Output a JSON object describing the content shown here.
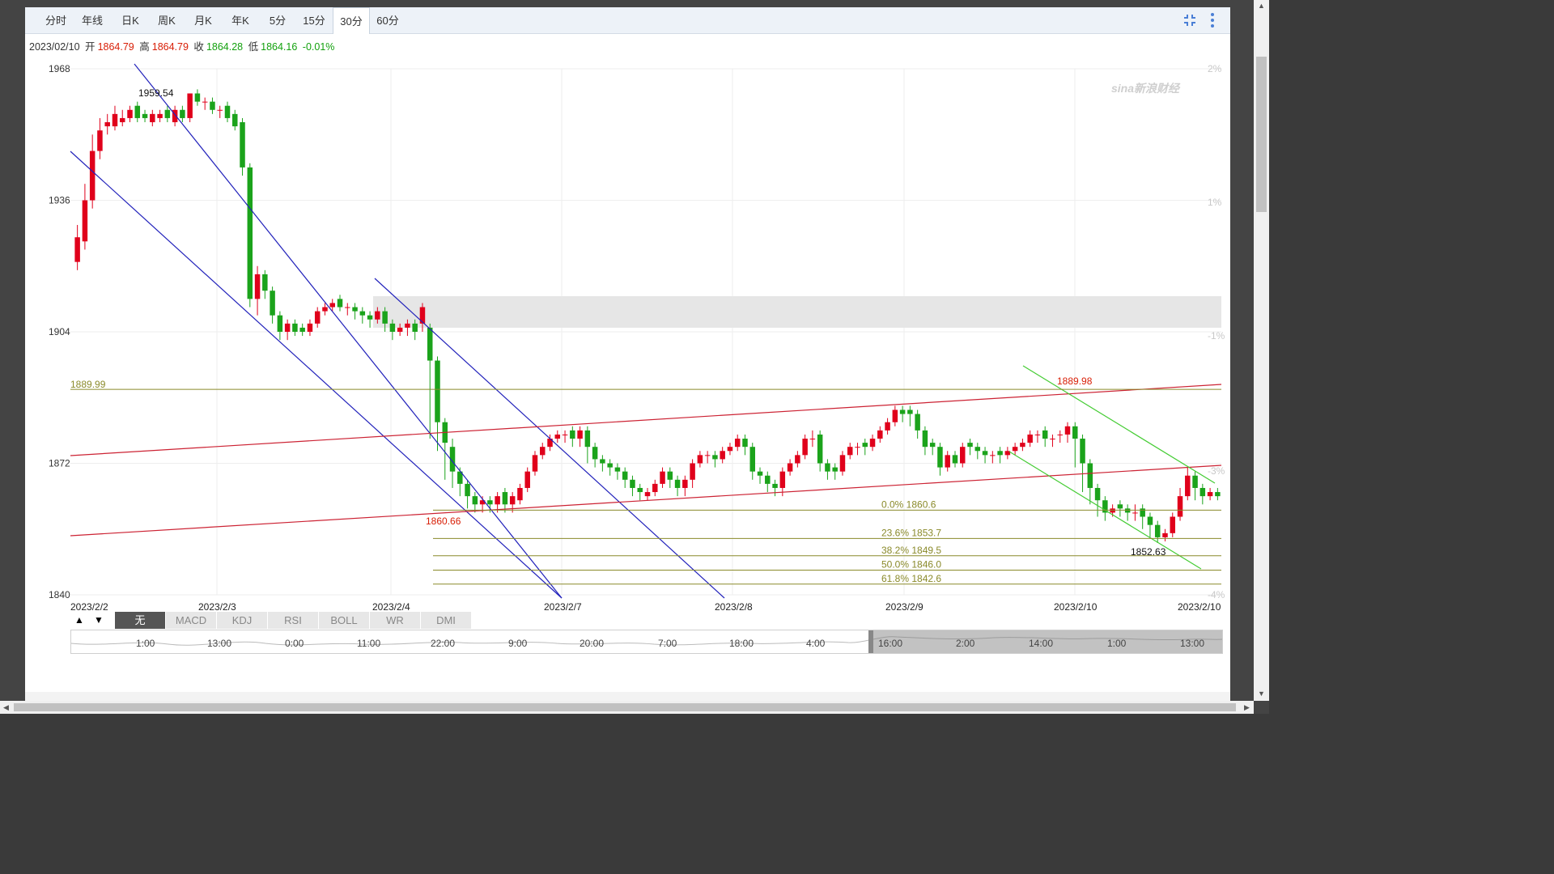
{
  "toolbar": {
    "tabs": [
      "分时",
      "年线",
      "日K",
      "周K",
      "月K",
      "年K",
      "5分",
      "15分",
      "30分",
      "60分"
    ],
    "active_tab": "30分"
  },
  "ohlc": {
    "date": "2023/02/10",
    "open_label": "开",
    "open": "1864.79",
    "high_label": "高",
    "high": "1864.79",
    "close_label": "收",
    "close": "1864.28",
    "low_label": "低",
    "low": "1864.16",
    "change": "-0.01%"
  },
  "watermark": "sina新浪财经",
  "chart_data": {
    "type": "candlestick",
    "title": "",
    "ylim": [
      1840,
      1968
    ],
    "y_ticks": [
      1968,
      1936,
      1904,
      1872,
      1840
    ],
    "pct_ticks": [
      "2%",
      "1%",
      "-1%",
      "-3%",
      "-4%"
    ],
    "x_labels": [
      "2023/2/2",
      "2023/2/3",
      "2023/2/4",
      "2023/2/7",
      "2023/2/8",
      "2023/2/9",
      "2023/2/10",
      "2023/2/10"
    ],
    "series": [
      {
        "name": "",
        "close": [
          1927,
          1936,
          1948,
          1953,
          1955,
          1957,
          1956,
          1958,
          1956,
          1956,
          1957,
          1957,
          1956,
          1958,
          1956,
          1962,
          1960,
          1960,
          1958,
          1958,
          1956,
          1954,
          1944,
          1912,
          1918,
          1914,
          1908,
          1904,
          1906,
          1904,
          1904,
          1906,
          1909,
          1910,
          1911,
          1910,
          1910,
          1909,
          1908,
          1907,
          1909,
          1906,
          1904,
          1905,
          1906,
          1904,
          1910,
          1897,
          1882,
          1877,
          1870,
          1867,
          1864,
          1862,
          1863,
          1862,
          1864,
          1862,
          1864,
          1866,
          1870,
          1874,
          1876,
          1878,
          1879,
          1879,
          1878,
          1880,
          1876,
          1873,
          1872,
          1871,
          1870,
          1868,
          1866,
          1865,
          1865,
          1867,
          1870,
          1868,
          1866,
          1868,
          1872,
          1874,
          1874,
          1873,
          1875,
          1876,
          1878,
          1876,
          1870,
          1869,
          1867,
          1866,
          1870,
          1872,
          1874,
          1878,
          1878,
          1872,
          1870,
          1870,
          1874,
          1876,
          1876,
          1876,
          1878,
          1880,
          1882,
          1885,
          1884,
          1884,
          1880,
          1876,
          1876,
          1871,
          1874,
          1872,
          1876,
          1876,
          1875,
          1874,
          1874,
          1874,
          1875,
          1876,
          1877,
          1879,
          1879,
          1878,
          1878,
          1879,
          1881,
          1878,
          1872,
          1866,
          1863,
          1860,
          1861,
          1861,
          1860,
          1860,
          1859,
          1857,
          1854,
          1855,
          1859,
          1864,
          1869,
          1866,
          1864,
          1865,
          1864
        ],
        "open": [
          1921,
          1926,
          1936,
          1948,
          1954,
          1954,
          1955,
          1956,
          1959,
          1957,
          1955,
          1956,
          1958,
          1955,
          1958,
          1956,
          1962,
          1960,
          1960,
          1958,
          1959,
          1957,
          1955,
          1944,
          1912,
          1918,
          1914,
          1908,
          1904,
          1906,
          1905,
          1904,
          1906,
          1909,
          1910,
          1912,
          1910,
          1910,
          1909,
          1908,
          1907,
          1909,
          1906,
          1904,
          1905,
          1906,
          1906,
          1905,
          1897,
          1882,
          1876,
          1870,
          1867,
          1864,
          1862,
          1863,
          1862,
          1865,
          1862,
          1863,
          1866,
          1870,
          1874,
          1876,
          1878,
          1879,
          1880,
          1878,
          1880,
          1876,
          1873,
          1872,
          1871,
          1870,
          1868,
          1866,
          1864,
          1865,
          1867,
          1870,
          1868,
          1866,
          1868,
          1872,
          1874,
          1874,
          1873,
          1875,
          1876,
          1878,
          1876,
          1870,
          1869,
          1867,
          1866,
          1870,
          1872,
          1874,
          1878,
          1879,
          1872,
          1871,
          1870,
          1874,
          1876,
          1877,
          1876,
          1878,
          1880,
          1882,
          1885,
          1885,
          1884,
          1880,
          1877,
          1876,
          1871,
          1874,
          1872,
          1877,
          1876,
          1875,
          1874,
          1875,
          1874,
          1875,
          1876,
          1877,
          1879,
          1880,
          1878,
          1879,
          1879,
          1881,
          1878,
          1872,
          1866,
          1863,
          1860,
          1862,
          1861,
          1860,
          1861,
          1859,
          1857,
          1854,
          1855,
          1859,
          1864,
          1869,
          1866,
          1864,
          1865
        ],
        "high": [
          1930,
          1940,
          1952,
          1956,
          1957,
          1959,
          1958,
          1959,
          1960,
          1958,
          1958,
          1958,
          1959,
          1959,
          1959,
          1962,
          1963,
          1961,
          1961,
          1959,
          1960,
          1958,
          1956,
          1945,
          1920,
          1919,
          1915,
          1909,
          1907,
          1907,
          1906,
          1907,
          1910,
          1911,
          1912,
          1913,
          1911,
          1911,
          1910,
          1909,
          1910,
          1910,
          1907,
          1906,
          1907,
          1907,
          1911,
          1906,
          1898,
          1883,
          1878,
          1871,
          1868,
          1865,
          1864,
          1864,
          1865,
          1866,
          1865,
          1867,
          1871,
          1875,
          1877,
          1879,
          1880,
          1880,
          1881,
          1881,
          1881,
          1877,
          1874,
          1873,
          1872,
          1871,
          1869,
          1867,
          1866,
          1868,
          1871,
          1871,
          1869,
          1869,
          1873,
          1875,
          1875,
          1875,
          1876,
          1877,
          1879,
          1879,
          1877,
          1871,
          1870,
          1868,
          1871,
          1873,
          1875,
          1879,
          1880,
          1880,
          1873,
          1872,
          1875,
          1877,
          1877,
          1878,
          1879,
          1881,
          1883,
          1886,
          1886,
          1886,
          1885,
          1881,
          1878,
          1877,
          1875,
          1875,
          1877,
          1878,
          1877,
          1876,
          1875,
          1876,
          1876,
          1877,
          1878,
          1880,
          1880,
          1881,
          1879,
          1880,
          1882,
          1882,
          1879,
          1873,
          1867,
          1864,
          1862,
          1863,
          1862,
          1862,
          1862,
          1860,
          1858,
          1856,
          1860,
          1866,
          1871,
          1870,
          1867,
          1866,
          1866
        ],
        "low": [
          1919,
          1924,
          1934,
          1946,
          1952,
          1953,
          1954,
          1955,
          1955,
          1955,
          1954,
          1955,
          1955,
          1954,
          1955,
          1955,
          1959,
          1958,
          1957,
          1956,
          1955,
          1953,
          1942,
          1910,
          1908,
          1912,
          1906,
          1902,
          1902,
          1903,
          1903,
          1903,
          1905,
          1908,
          1909,
          1909,
          1908,
          1907,
          1906,
          1905,
          1906,
          1904,
          1902,
          1903,
          1903,
          1902,
          1904,
          1878,
          1875,
          1868,
          1866,
          1864,
          1861,
          1860,
          1860,
          1860,
          1860,
          1860,
          1860,
          1862,
          1865,
          1869,
          1873,
          1875,
          1877,
          1877,
          1876,
          1876,
          1872,
          1871,
          1870,
          1869,
          1868,
          1866,
          1864,
          1863,
          1863,
          1864,
          1866,
          1866,
          1864,
          1864,
          1866,
          1871,
          1872,
          1871,
          1872,
          1874,
          1875,
          1874,
          1868,
          1867,
          1865,
          1864,
          1864,
          1869,
          1871,
          1873,
          1876,
          1870,
          1868,
          1868,
          1869,
          1873,
          1874,
          1874,
          1875,
          1877,
          1879,
          1881,
          1882,
          1881,
          1878,
          1874,
          1874,
          1869,
          1870,
          1871,
          1871,
          1874,
          1873,
          1872,
          1872,
          1872,
          1873,
          1874,
          1875,
          1876,
          1877,
          1876,
          1876,
          1877,
          1877,
          1871,
          1865,
          1862,
          1859,
          1858,
          1859,
          1859,
          1858,
          1858,
          1856,
          1854,
          1852.6,
          1853,
          1854,
          1858,
          1863,
          1863,
          1862,
          1863,
          1863
        ]
      }
    ],
    "highs_lows_labels": {
      "high_1": "1959.54",
      "low_1": "1860.66",
      "high_2": "1889.98",
      "low_2": "1852.63"
    },
    "hline": {
      "label": "1889.99",
      "value": 1889.99
    },
    "fibonacci": [
      {
        "label": "0.0% 1860.6",
        "value": 1860.6
      },
      {
        "label": "23.6% 1853.7",
        "value": 1853.7
      },
      {
        "label": "38.2% 1849.5",
        "value": 1849.5
      },
      {
        "label": "50.0% 1846.0",
        "value": 1846.0
      },
      {
        "label": "61.8% 1842.6",
        "value": 1842.6
      }
    ]
  },
  "indicators": {
    "arrows": [
      "▲",
      "▼"
    ],
    "tabs": [
      "无",
      "MACD",
      "KDJ",
      "RSI",
      "BOLL",
      "WR",
      "DMI"
    ],
    "active": "无"
  },
  "navigator": {
    "labels": [
      "1:00",
      "13:00",
      "0:00",
      "11:00",
      "22:00",
      "9:00",
      "20:00",
      "7:00",
      "18:00",
      "4:00",
      "16:00",
      "2:00",
      "14:00",
      "1:00",
      "13:00"
    ]
  }
}
